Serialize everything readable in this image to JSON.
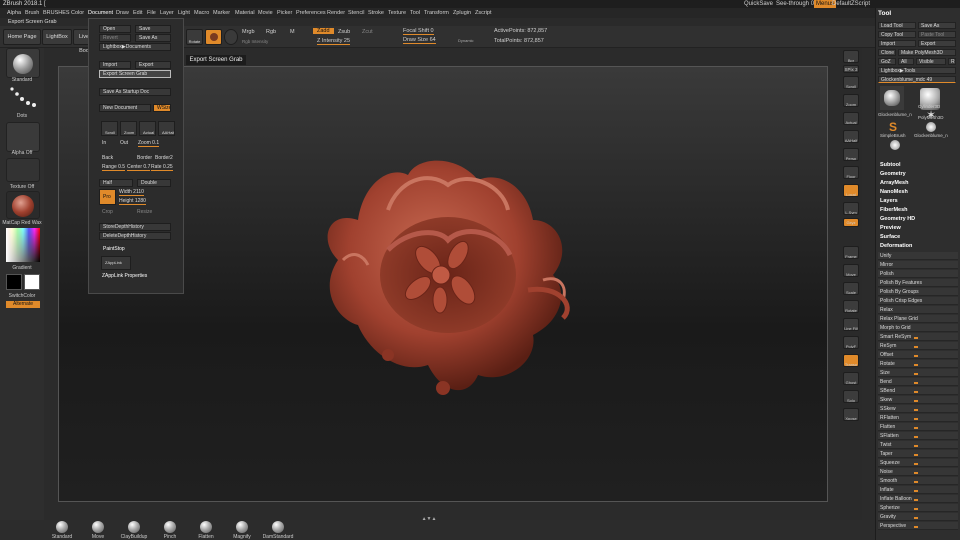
{
  "titlebar": {
    "title": "ZBrush 2018.1 [",
    "quicksave": "QuickSave",
    "seethrough": "See-through 0",
    "menus": "Menus",
    "script": "DefaultZScript"
  },
  "menubar": [
    "Alpha",
    "Brush",
    "BRUSHES",
    "Color",
    "Document",
    "Draw",
    "Edit",
    "File",
    "Layer",
    "Light",
    "Macro",
    "Marker",
    "Material",
    "Movie",
    "Picker",
    "Preferences",
    "Render",
    "Stencil",
    "Stroke",
    "Texture",
    "Tool",
    "Transform",
    "Zplugin",
    "Zscript"
  ],
  "subbar": {
    "label": "Export Screen Grab"
  },
  "topshelf": {
    "home": "Home Page",
    "lightbox": "LightBox",
    "liveboolean": "Live Boo",
    "rotate": "Rotate",
    "mrgb": "Mrgb",
    "rgb": "Rgb",
    "m": "M",
    "zadd": "Zadd",
    "zsub": "Zsub",
    "zcut": "Zcut",
    "rgb_intensity": "Rgb Intensity",
    "z_intensity": "Z Intensity 25",
    "focal_shift": "Focal Shift 0",
    "draw_size": "Draw Size 64",
    "dynamic": "Dynamic",
    "active_points": "ActivePoints: 872,857",
    "total_points": "TotalPoints: 872,857"
  },
  "leftpanel": {
    "standard": "Standard",
    "dots": "Dots",
    "alpha": "Alpha Off",
    "texture": "Texture Off",
    "material": "MatCap Red Wax",
    "gradient": "Gradient",
    "switchcolor": "SwitchColor",
    "alternate": "Alternate"
  },
  "viewport": {
    "title": "Export Screen Grab"
  },
  "document_menu": {
    "open": "Open",
    "save": "Save",
    "revert": "Revert",
    "save_as": "Save As",
    "lightbox_docs": "Lightbox▶Documents",
    "import": "Import",
    "export": "Export",
    "export_grab": "Export Screen Grab",
    "save_startup": "Save As Startup Doc",
    "new_doc": "New Document",
    "wsize": "WSize",
    "scroll": "Scroll",
    "zoom": "Zoom",
    "actual": "Actual",
    "aahalf": "AAHalf",
    "in": "In",
    "out": "Out",
    "zoom_val": "Zoom 0.1",
    "back": "Back",
    "border": "Border",
    "border2": "Border2",
    "range": "Range 0.5",
    "center": "Center 0.7",
    "rate": "Rate 0.25",
    "half": "Half",
    "double": "Double",
    "pro": "Pro",
    "width": "Width 2110",
    "height": "Height 1280",
    "crop": "Crop",
    "resize": "Resize",
    "store_depth": "StoreDepthHistory",
    "delete_depth": "DeleteDepthHistory",
    "paintstop": "PaintStop",
    "zapplink": "ZAppLink",
    "zapplink_props": "ZAppLink Properties"
  },
  "bottomshelf": [
    "Standard",
    "Move",
    "ClayBuildup",
    "Pinch",
    "Flatten",
    "Magnify",
    "DamStandard"
  ],
  "righttools": [
    "Bpr",
    "SPix 3",
    "Scroll",
    "Zoom",
    "Actual",
    "AAHalf",
    "Persp",
    "Floor",
    "Local",
    "L.Sym",
    "Gxyz",
    "Frame",
    "Move",
    "Scale",
    "Rotate",
    "Line Fill",
    "PolyF",
    "Transp",
    "Ghost",
    "Solo",
    "Xpose"
  ],
  "toolpanel": {
    "title": "Tool",
    "load": "Load Tool",
    "save_as": "Save As",
    "copy": "Copy Tool",
    "paste": "Paste Tool",
    "import": "Import",
    "export": "Export",
    "clone": "Clone",
    "make_poly": "Make PolyMesh3D",
    "goz": "GoZ",
    "all": "All",
    "visible": "Visible",
    "r": "R",
    "lightbox_tools": "Lightbox▶Tools",
    "current": "Glockenblume_mdc 49",
    "thumbs": [
      "Glockenblume_n",
      "Cylinder3D",
      "SimpleBrush",
      "PolyMesh3D",
      "Glockenblume_n"
    ],
    "sections": [
      "Subtool",
      "Geometry",
      "ArrayMesh",
      "NanoMesh",
      "Layers",
      "FiberMesh",
      "Geometry HD",
      "Preview",
      "Surface",
      "Deformation"
    ],
    "deform_items": [
      "Unify",
      "Mirror",
      "Polish",
      "Polish By Features",
      "Polish By Groups",
      "Polish Crisp Edges",
      "Relax",
      "Relax Plane Grid",
      "Morph to Grid",
      "Smart ReSym",
      "ReSym",
      "Offset",
      "Rotate",
      "Size",
      "Bend",
      "SBend",
      "Skew",
      "SSkew",
      "RFlatten",
      "Flatten",
      "SFlatten",
      "Twist",
      "Taper",
      "Squeeze",
      "Noise",
      "Smooth",
      "Inflate",
      "Inflate Balloon",
      "Spherize",
      "Gravity",
      "Perspective"
    ]
  },
  "colors": {
    "accent": "#e08a2a",
    "clay": "#a0412f"
  }
}
